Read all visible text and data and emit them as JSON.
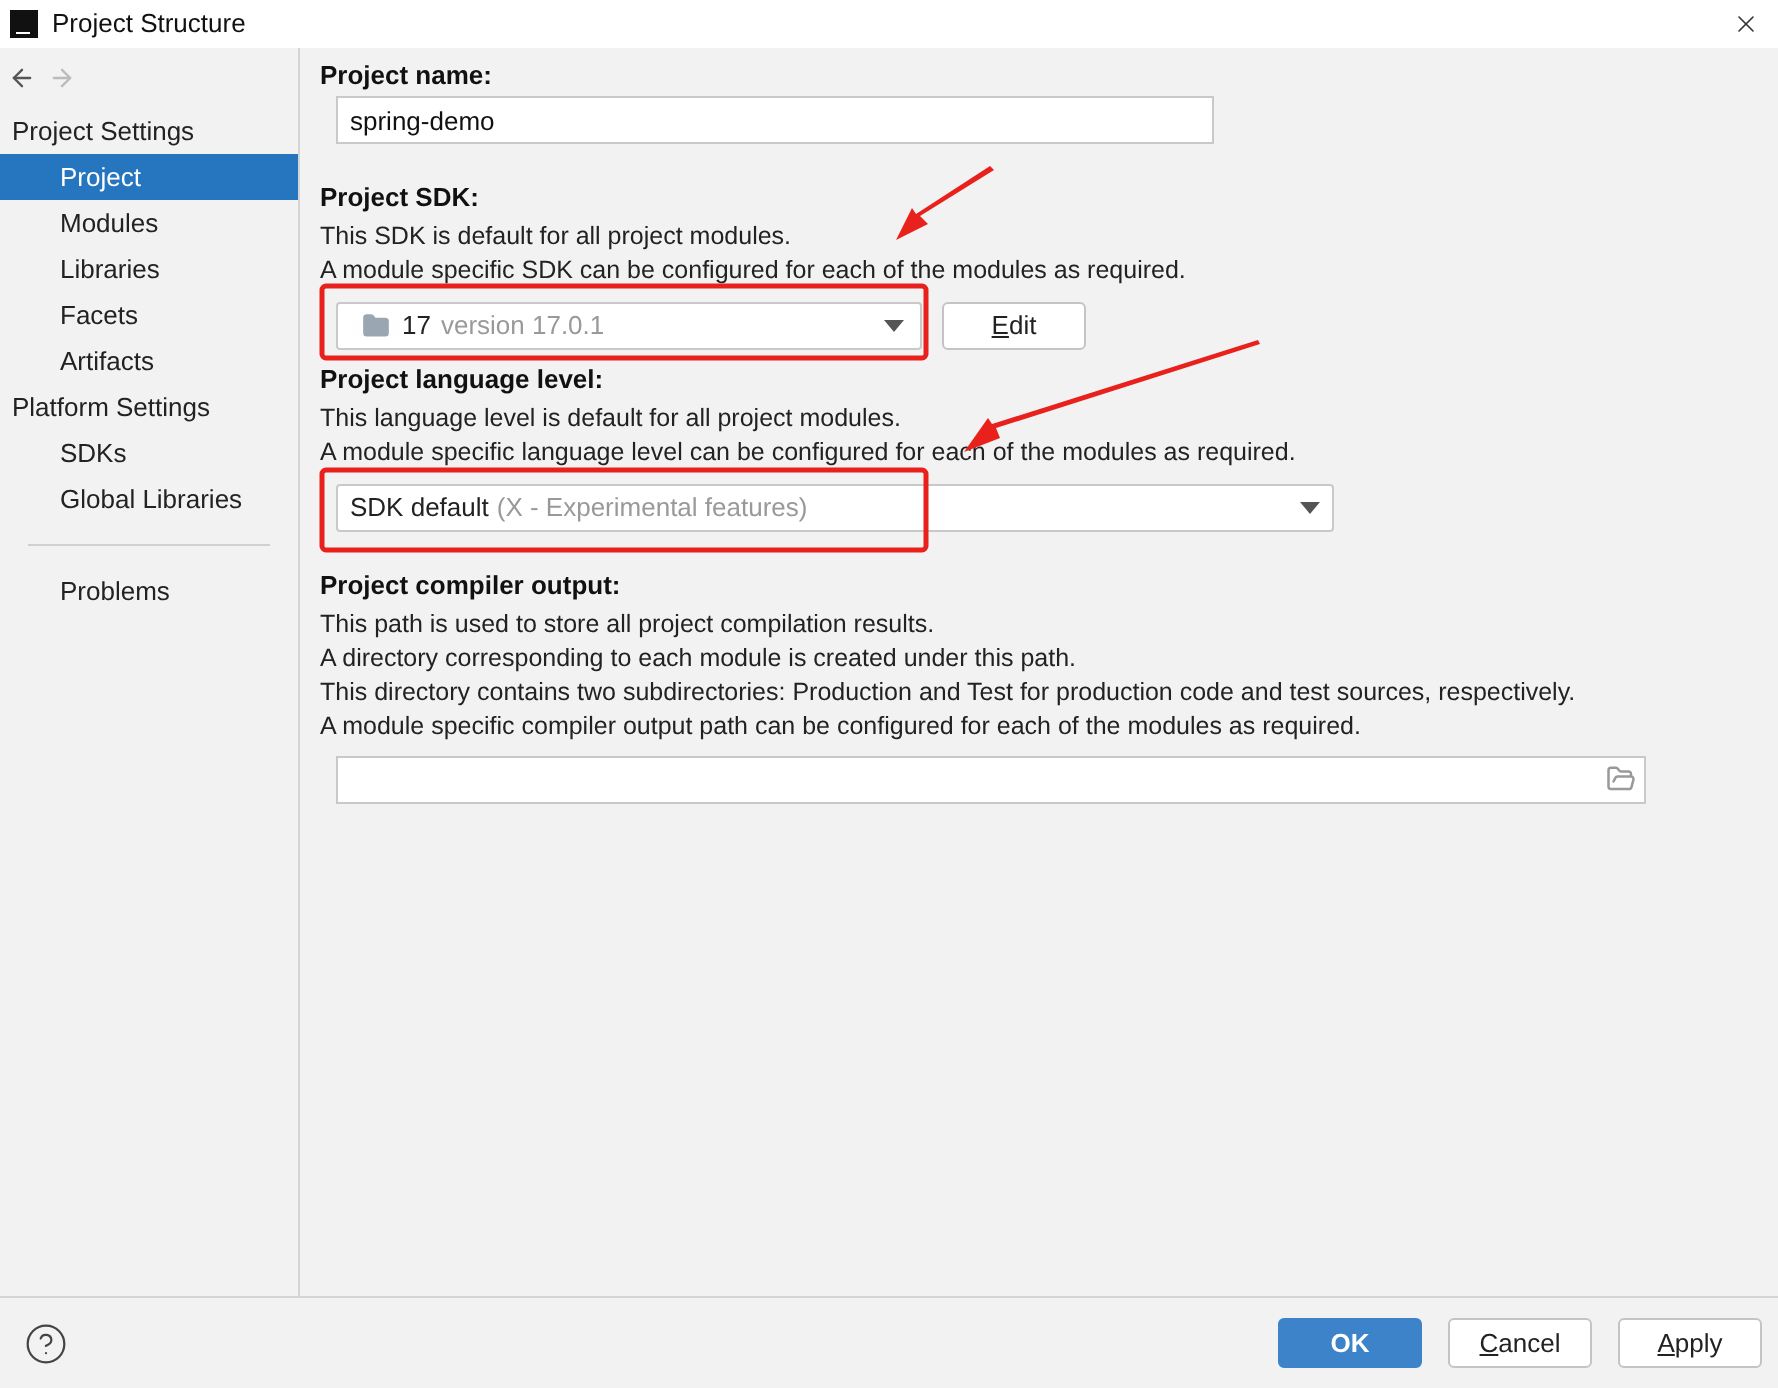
{
  "window": {
    "title": "Project Structure"
  },
  "sidebar": {
    "groups": [
      {
        "label": "Project Settings",
        "items": [
          {
            "label": "Project",
            "selected": true
          },
          {
            "label": "Modules",
            "selected": false
          },
          {
            "label": "Libraries",
            "selected": false
          },
          {
            "label": "Facets",
            "selected": false
          },
          {
            "label": "Artifacts",
            "selected": false
          }
        ]
      },
      {
        "label": "Platform Settings",
        "items": [
          {
            "label": "SDKs",
            "selected": false
          },
          {
            "label": "Global Libraries",
            "selected": false
          }
        ]
      }
    ],
    "extra_items": [
      {
        "label": "Problems",
        "selected": false
      }
    ]
  },
  "project_name": {
    "label": "Project name:",
    "value": "spring-demo"
  },
  "project_sdk": {
    "label": "Project SDK:",
    "description": [
      "This SDK is default for all project modules.",
      "A module specific SDK can be configured for each of the modules as required."
    ],
    "dropdown": {
      "value": "17",
      "detail": "version 17.0.1"
    },
    "edit_button": "Edit"
  },
  "language_level": {
    "label": "Project language level:",
    "description": [
      "This language level is default for all project modules.",
      "A module specific language level can be configured for each of the modules as required."
    ],
    "dropdown": {
      "value": "SDK default",
      "detail": "(X - Experimental features)"
    }
  },
  "compiler_output": {
    "label": "Project compiler output:",
    "description": [
      "This path is used to store all project compilation results.",
      "A directory corresponding to each module is created under this path.",
      "This directory contains two subdirectories: Production and Test for production code and test sources, respectively.",
      "A module specific compiler output path can be configured for each of the modules as required."
    ]
  },
  "buttons": [
    {
      "label": "OK",
      "kind": "primary"
    },
    {
      "label": "Cancel",
      "kind": "secondary"
    },
    {
      "label": "Apply",
      "kind": "secondary"
    }
  ]
}
